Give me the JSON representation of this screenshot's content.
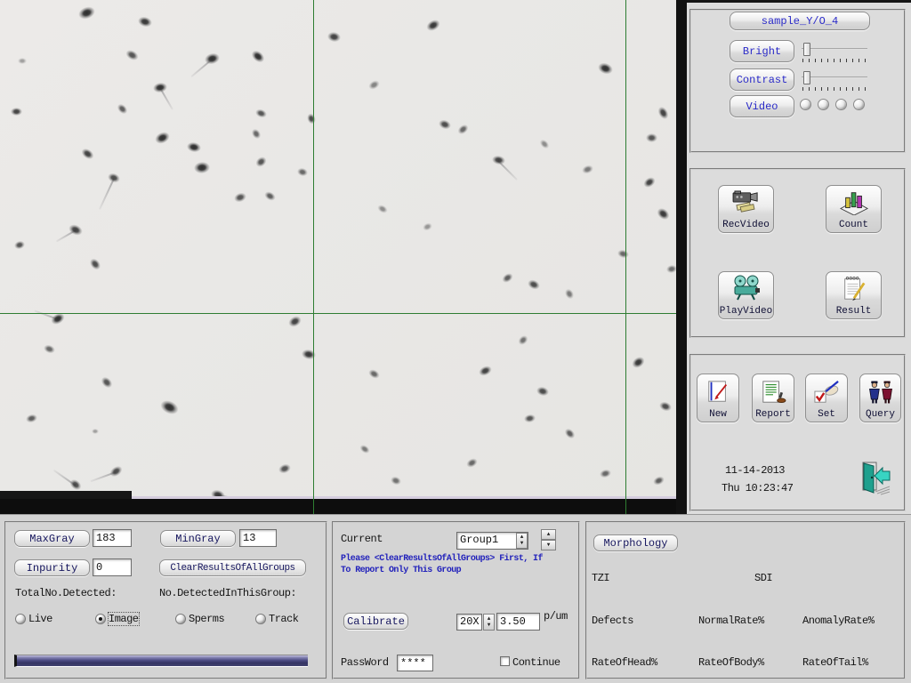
{
  "right_panel": {
    "sample_button": "sample_Y/O_4",
    "bright_label": "Bright",
    "contrast_label": "Contrast",
    "video_label": "Video",
    "bright_slider_pos": 0.03,
    "contrast_slider_pos": 0.03,
    "rec_video_label": "RecVideo",
    "count_label": "Count",
    "play_video_label": "PlayVideo",
    "result_label": "Result",
    "new_label": "New",
    "report_label": "Report",
    "set_label": "Set",
    "query_label": "Query",
    "date": "11-14-2013",
    "time": "Thu 10:23:47"
  },
  "bottom_left": {
    "max_gray_label": "MaxGray",
    "max_gray_value": "183",
    "min_gray_label": "MinGray",
    "min_gray_value": "13",
    "inpurity_label": "Inpurity",
    "inpurity_value": "0",
    "clear_button": "ClearResultsOfAllGroups",
    "total_detected_label": "TotalNo.Detected:",
    "group_detected_label": "No.DetectedInThisGroup:",
    "radios": [
      {
        "label": "Live",
        "selected": false
      },
      {
        "label": "Image",
        "selected": true
      },
      {
        "label": "Sperms",
        "selected": false
      },
      {
        "label": "Track",
        "selected": false
      }
    ]
  },
  "bottom_middle": {
    "current_label": "Current",
    "group_value": "Group1",
    "notice_line1": "Please <ClearResultsOfAllGroups> First, If",
    "notice_line2": "To Report Only This Group",
    "calibrate_label": "Calibrate",
    "magnification": "20X",
    "scale_value": "3.50",
    "scale_unit": "p/um",
    "password_label": "PassWord",
    "password_value": "****",
    "continue_label": "Continue",
    "continue_checked": false
  },
  "bottom_right": {
    "morphology_label": "Morphology",
    "labels": [
      "TZI",
      "SDI",
      "Defects",
      "NormalRate%",
      "AnomalyRate%",
      "RateOfHead%",
      "RateOfBody%",
      "RateOfTail%"
    ]
  },
  "colors": {
    "grid_green": "#2e7d32",
    "blue_button_text": "#2a2ac8",
    "notice_blue": "#2222bb",
    "progress_navy": "#353464",
    "panel_gray": "#dcdcdc"
  },
  "microscopy": {
    "crosshair": {
      "v1": 352,
      "v2": 703,
      "h1": 352
    },
    "cells": [
      [
        97,
        14,
        19,
        13,
        -20,
        1
      ],
      [
        163,
        24,
        16,
        11,
        15,
        0.95
      ],
      [
        148,
        62,
        15,
        10,
        30,
        0.8
      ],
      [
        25,
        68,
        10,
        7,
        0,
        0.4
      ],
      [
        238,
        66,
        17,
        12,
        -15,
        1,
        140,
        30
      ],
      [
        290,
        63,
        16,
        11,
        40,
        1
      ],
      [
        375,
        41,
        15,
        11,
        10,
        0.9
      ],
      [
        487,
        28,
        16,
        11,
        -30,
        0.95
      ],
      [
        680,
        77,
        17,
        12,
        20,
        1
      ],
      [
        745,
        127,
        15,
        10,
        60,
        0.9
      ],
      [
        732,
        155,
        13,
        10,
        0,
        0.8
      ],
      [
        730,
        205,
        14,
        10,
        -35,
        0.9
      ],
      [
        745,
        240,
        15,
        11,
        40,
        0.95
      ],
      [
        18,
        125,
        13,
        9,
        0,
        0.9
      ],
      [
        137,
        122,
        13,
        9,
        45,
        0.75
      ],
      [
        180,
        98,
        16,
        11,
        -10,
        1,
        60,
        28
      ],
      [
        293,
        127,
        13,
        9,
        20,
        0.8
      ],
      [
        350,
        133,
        12,
        9,
        70,
        0.85
      ],
      [
        182,
        155,
        17,
        12,
        -25,
        1
      ],
      [
        218,
        165,
        16,
        11,
        10,
        1
      ],
      [
        227,
        188,
        18,
        13,
        -5,
        1
      ],
      [
        98,
        173,
        15,
        10,
        35,
        0.9
      ],
      [
        288,
        150,
        12,
        9,
        55,
        0.7
      ],
      [
        128,
        200,
        14,
        10,
        20,
        0.85,
        115,
        38
      ],
      [
        293,
        182,
        13,
        10,
        -40,
        0.8
      ],
      [
        340,
        193,
        12,
        9,
        15,
        0.7
      ],
      [
        270,
        222,
        14,
        10,
        -20,
        0.8
      ],
      [
        303,
        220,
        13,
        9,
        30,
        0.75
      ],
      [
        85,
        258,
        16,
        11,
        25,
        0.9,
        150,
        25
      ],
      [
        22,
        275,
        12,
        9,
        -15,
        0.8
      ],
      [
        107,
        297,
        14,
        10,
        50,
        0.85
      ],
      [
        420,
        95,
        13,
        9,
        -30,
        0.55
      ],
      [
        500,
        140,
        14,
        10,
        20,
        0.85
      ],
      [
        520,
        145,
        13,
        9,
        -40,
        0.7
      ],
      [
        560,
        180,
        15,
        10,
        10,
        0.9,
        45,
        30
      ],
      [
        612,
        162,
        12,
        8,
        45,
        0.5
      ],
      [
        660,
        190,
        13,
        9,
        -20,
        0.6
      ],
      [
        600,
        320,
        14,
        10,
        25,
        0.85
      ],
      [
        570,
        312,
        13,
        9,
        -35,
        0.75
      ],
      [
        640,
        330,
        12,
        9,
        60,
        0.6
      ],
      [
        700,
        285,
        13,
        9,
        15,
        0.7
      ],
      [
        755,
        302,
        12,
        9,
        -10,
        0.65
      ],
      [
        430,
        235,
        12,
        8,
        30,
        0.5
      ],
      [
        480,
        255,
        11,
        8,
        -25,
        0.45
      ],
      [
        65,
        358,
        16,
        11,
        -30,
        1,
        200,
        28
      ],
      [
        55,
        392,
        13,
        9,
        20,
        0.7
      ],
      [
        120,
        430,
        14,
        10,
        45,
        0.8
      ],
      [
        35,
        470,
        13,
        9,
        -15,
        0.75
      ],
      [
        190,
        458,
        21,
        14,
        25,
        1
      ],
      [
        130,
        530,
        15,
        10,
        -35,
        0.85,
        160,
        30
      ],
      [
        245,
        556,
        16,
        11,
        15,
        0.95,
        10,
        26
      ],
      [
        320,
        527,
        14,
        10,
        -20,
        0.8
      ],
      [
        331,
        361,
        15,
        11,
        -30,
        0.9
      ],
      [
        347,
        398,
        16,
        11,
        10,
        0.95
      ],
      [
        85,
        545,
        14,
        10,
        40,
        0.85,
        215,
        30
      ],
      [
        107,
        485,
        8,
        6,
        0,
        0.4
      ],
      [
        420,
        420,
        13,
        9,
        30,
        0.7
      ],
      [
        545,
        417,
        15,
        10,
        -25,
        0.9
      ],
      [
        610,
        440,
        14,
        10,
        15,
        0.85
      ],
      [
        717,
        407,
        15,
        11,
        -35,
        0.95
      ],
      [
        748,
        457,
        14,
        10,
        20,
        0.85
      ],
      [
        595,
        470,
        13,
        9,
        -10,
        0.8
      ],
      [
        640,
        487,
        13,
        9,
        45,
        0.75
      ],
      [
        530,
        520,
        13,
        9,
        -30,
        0.7
      ],
      [
        445,
        540,
        12,
        9,
        20,
        0.65
      ],
      [
        680,
        532,
        13,
        9,
        -15,
        0.7
      ],
      [
        410,
        505,
        12,
        8,
        35,
        0.6
      ],
      [
        588,
        382,
        12,
        9,
        -45,
        0.65
      ],
      [
        740,
        540,
        13,
        9,
        -25,
        0.75
      ]
    ]
  }
}
